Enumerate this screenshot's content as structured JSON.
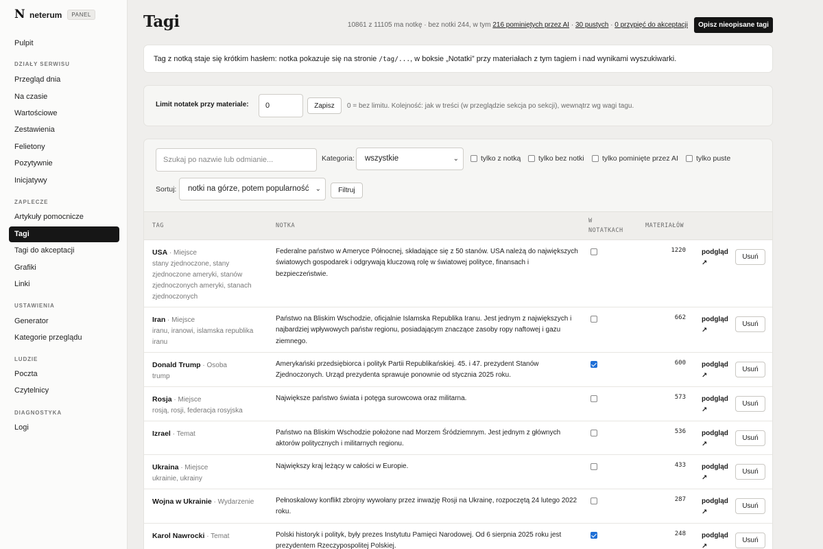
{
  "brand": {
    "logo": "N",
    "name": "neterum",
    "badge": "PANEL"
  },
  "nav": {
    "pulpit": "Pulpit",
    "sec_dzialy": "DZIAŁY SERWISU",
    "przeglad": "Przegląd dnia",
    "na_czasie": "Na czasie",
    "wartosciowe": "Wartościowe",
    "zestawienia": "Zestawienia",
    "felietony": "Felietony",
    "pozytywnie": "Pozytywnie",
    "inicjatywy": "Inicjatywy",
    "sec_zaplecze": "ZAPLECZE",
    "artykuly": "Artykuły pomocnicze",
    "tagi": "Tagi",
    "tagi_akceptacja": "Tagi do akceptacji",
    "grafiki": "Grafiki",
    "linki": "Linki",
    "sec_ustawienia": "USTAWIENIA",
    "generator": "Generator",
    "kategorie": "Kategorie przeglądu",
    "sec_ludzie": "LUDZIE",
    "poczta": "Poczta",
    "czytelnicy": "Czytelnicy",
    "sec_diag": "DIAGNOSTYKA",
    "logi": "Logi"
  },
  "page": {
    "title": "Tagi",
    "stats_prefix": "10861 z 11105 ma notkę · bez notki 244, w tym",
    "stats_skipped": "216 pominiętych przez AI",
    "stats_sep1": "·",
    "stats_empty": "30 pustych",
    "stats_sep2": "·",
    "stats_pending": "0 przypięć do akceptacji",
    "describe_button": "Opisz nieopisane tagi",
    "info_before": "Tag z notką staje się krótkim hasłem: notka pokazuje się na stronie",
    "info_code": "/tag/...",
    "info_after": ", w boksie „Notatki” przy materiałach z tym tagiem i nad wynikami wyszukiwarki."
  },
  "limit": {
    "label": "Limit notatek przy materiale:",
    "value": "0",
    "save": "Zapisz",
    "hint": "0 = bez limitu. Kolejność: jak w treści (w przeglądzie sekcja po sekcji), wewnątrz wg wagi tagu."
  },
  "filters": {
    "search_placeholder": "Szukaj po nazwie lub odmianie...",
    "category_label": "Kategoria:",
    "category_value": "wszystkie",
    "only_with_note": "tylko z notką",
    "only_without_note": "tylko bez notki",
    "only_skipped_ai": "tylko pominięte przez AI",
    "only_empty": "tylko puste",
    "sort_label": "Sortuj:",
    "sort_value": "notki na górze, potem popularność",
    "filter_button": "Filtruj"
  },
  "table": {
    "headers": {
      "tag": "TAG",
      "note": "NOTKA",
      "in_notes_1": "W",
      "in_notes_2": "NOTATKACH",
      "materials": "MATERIAŁÓW"
    },
    "preview_label": "podgląd",
    "preview_arrow": "↗",
    "delete_label": "Usuń",
    "rows": [
      {
        "name": "USA",
        "type": "· Miejsce",
        "variants": "stany zjednoczone, stany zjednoczone ameryki, stanów zjednoczonych ameryki, stanach zjednoczonych",
        "note": "Federalne państwo w Ameryce Północnej, składające się z 50 stanów. USA należą do największych światowych gospodarek i odgrywają kluczową rolę w światowej polityce, finansach i bezpieczeństwie.",
        "in_notes": false,
        "count": "1220"
      },
      {
        "name": "Iran",
        "type": "· Miejsce",
        "variants": "iranu, iranowi, islamska republika iranu",
        "note": "Państwo na Bliskim Wschodzie, oficjalnie Islamska Republika Iranu. Jest jednym z największych i najbardziej wpływowych państw regionu, posiadającym znaczące zasoby ropy naftowej i gazu ziemnego.",
        "in_notes": false,
        "count": "662"
      },
      {
        "name": "Donald Trump",
        "type": "· Osoba",
        "variants": "trump",
        "note": "Amerykański przedsiębiorca i polityk Partii Republikańskiej. 45. i 47. prezydent Stanów Zjednoczonych. Urząd prezydenta sprawuje ponownie od stycznia 2025 roku.",
        "in_notes": true,
        "count": "600"
      },
      {
        "name": "Rosja",
        "type": "· Miejsce",
        "variants": "rosją, rosji, federacja rosyjska",
        "note": "Największe państwo świata i potęga surowcowa oraz militarna.",
        "in_notes": false,
        "count": "573"
      },
      {
        "name": "Izrael",
        "type": "· Temat",
        "variants": "",
        "note": "Państwo na Bliskim Wschodzie położone nad Morzem Śródziemnym. Jest jednym z głównych aktorów politycznych i militarnych regionu.",
        "in_notes": false,
        "count": "536"
      },
      {
        "name": "Ukraina",
        "type": "· Miejsce",
        "variants": "ukrainie, ukrainy",
        "note": "Największy kraj leżący w całości w Europie.",
        "in_notes": false,
        "count": "433"
      },
      {
        "name": "Wojna w Ukrainie",
        "type": "· Wydarzenie",
        "variants": "",
        "note": "Pełnoskalowy konflikt zbrojny wywołany przez inwazję Rosji na Ukrainę, rozpoczętą 24 lutego 2022 roku.",
        "in_notes": false,
        "count": "287"
      },
      {
        "name": "Karol Nawrocki",
        "type": "· Temat",
        "variants": "",
        "note": "Polski historyk i polityk, były prezes Instytutu Pamięci Narodowej. Od 6 sierpnia 2025 roku jest prezydentem Rzeczypospolitej Polskiej.",
        "in_notes": true,
        "count": "248"
      }
    ]
  }
}
